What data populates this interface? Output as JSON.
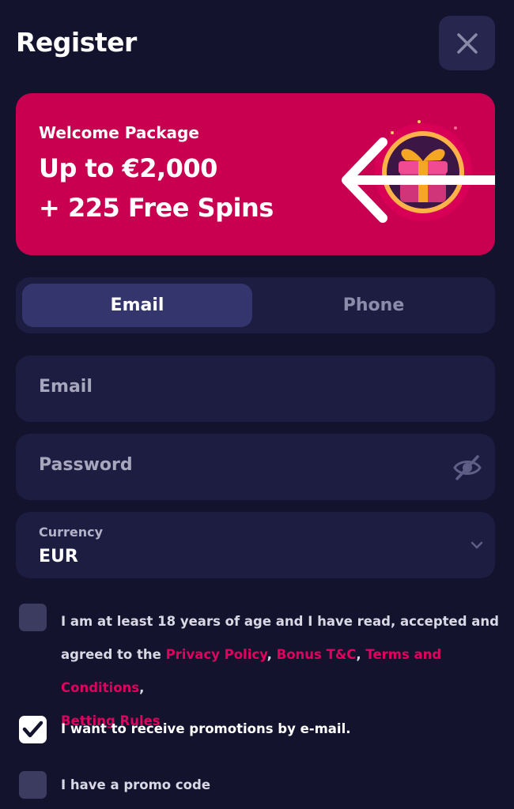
{
  "header": {
    "title": "Register"
  },
  "banner": {
    "kicker": "Welcome Package",
    "line1": "Up to €2,000",
    "line2": "+ 225 Free Spins"
  },
  "tabs": [
    {
      "label": "Email",
      "active": true
    },
    {
      "label": "Phone",
      "active": false
    }
  ],
  "form": {
    "email_placeholder": "Email",
    "password_placeholder": "Password",
    "currency_label": "Currency",
    "currency_value": "EUR"
  },
  "checkboxes": {
    "age": {
      "checked": false,
      "text_before": "I am at least 18 years of age and I have read, accepted and agreed to the ",
      "link1": "Privacy Policy",
      "sep1": ", ",
      "link2": "Bonus T&C",
      "sep2": ", ",
      "link3": "Terms and Conditions",
      "sep3": ", ",
      "link4": "Betting Rules"
    },
    "promotions": {
      "checked": true,
      "label": "I want to receive promotions by e-mail."
    },
    "promo_code": {
      "checked": false,
      "label": "I have a promo code"
    }
  },
  "colors": {
    "background": "#13132e",
    "banner": "#c8004f",
    "accent_link": "#e0005e",
    "field": "#1d1d42",
    "active_tab": "#35356e"
  },
  "icons": [
    "close-icon",
    "gift-icon",
    "arrow-left-icon",
    "eye-off-icon",
    "chevron-down-icon",
    "checkmark-icon"
  ]
}
